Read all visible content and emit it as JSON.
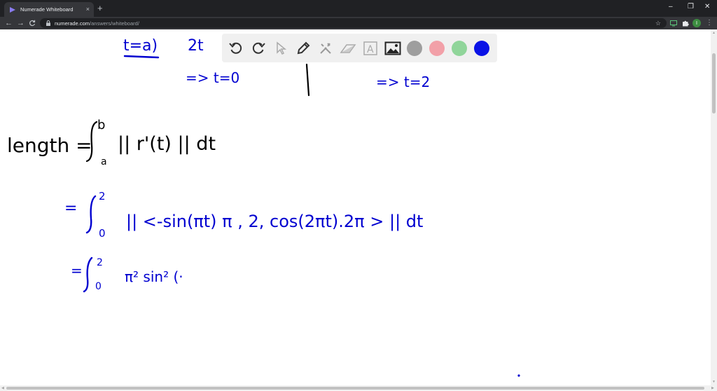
{
  "browser": {
    "tab_title": "Numerade Whiteboard",
    "tab_close": "×",
    "new_tab": "+",
    "url_host": "numerade.com",
    "url_path": "/answers/whiteboard/",
    "minimize": "–",
    "restore": "❐",
    "close": "✕",
    "avatar_letter": "I",
    "nav_back": "←",
    "nav_forward": "→",
    "nav_reload": "C",
    "bookmark_star": "☆",
    "menu": "⋮"
  },
  "whiteboard": {
    "tools": [
      "undo-icon",
      "redo-icon",
      "select-icon",
      "pen-icon",
      "tools-icon",
      "eraser-icon",
      "text-icon",
      "image-icon"
    ],
    "text_tool_label": "A",
    "colors": [
      "#9e9e9e",
      "#f2a0a8",
      "#90d59a",
      "#0a12e6"
    ]
  },
  "handwriting": {
    "line1_left": "t=a)",
    "line1_right": "2t",
    "line2_left": "=> t=0",
    "line2_right": "=> t=2",
    "length_label": "length =",
    "length_integral_upper": "b",
    "length_integral_lower": "a",
    "length_integrand": "|| r'(t) || dt",
    "step1_upper": "2",
    "step1_lower": "0",
    "step1_integrand": "|| <-sin(πt) π , 2, cos(2πt).2π > || dt",
    "step2_upper": "2",
    "step2_lower": "0",
    "step2_integrand": "π² sin² (·"
  }
}
